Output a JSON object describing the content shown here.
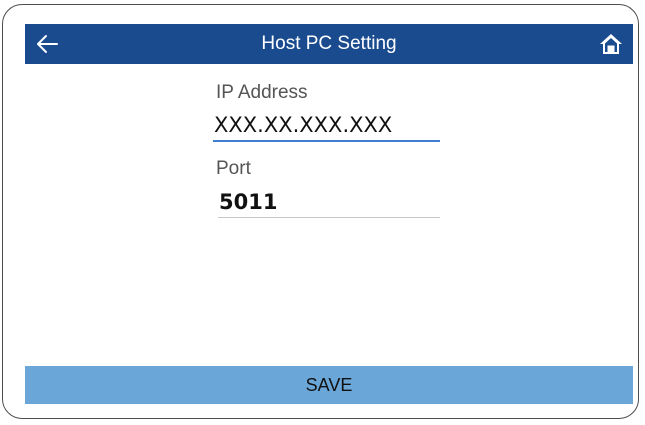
{
  "header": {
    "title": "Host PC Setting",
    "back_icon": "arrow-left-icon",
    "home_icon": "home-icon",
    "background_color": "#1a4b8f"
  },
  "form": {
    "ip_address": {
      "label": "IP Address",
      "value": "XXX.XX.XXX.XXX"
    },
    "port": {
      "label": "Port",
      "value": "5011"
    }
  },
  "footer": {
    "save_label": "SAVE",
    "background_color": "#6ba6d9"
  }
}
